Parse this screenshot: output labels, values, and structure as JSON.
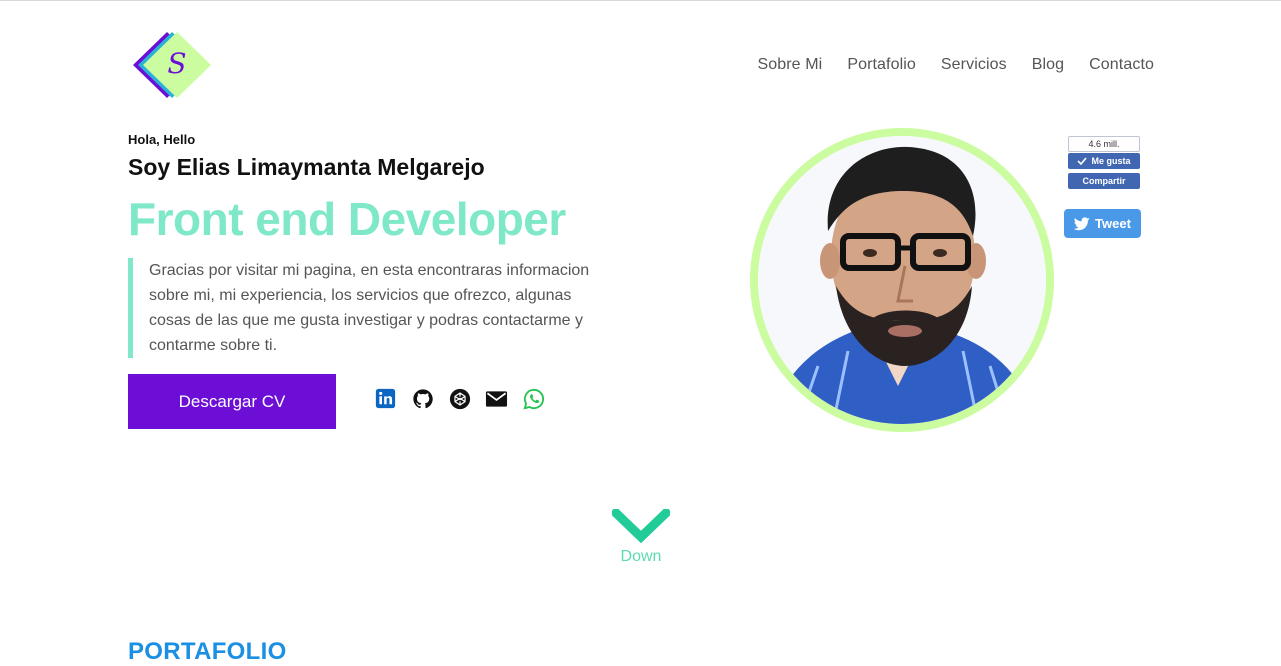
{
  "nav": {
    "items": [
      "Sobre Mi",
      "Portafolio",
      "Servicios",
      "Blog",
      "Contacto"
    ]
  },
  "logo": {
    "letter": "S"
  },
  "hero": {
    "greeting": "Hola, Hello",
    "name": "Soy Elias Limaymanta Melgarejo",
    "role": "Front end Developer",
    "intro": "Gracias por visitar mi pagina, en esta encontraras informacion sobre mi, mi experiencia, los servicios que ofrezco, algunas cosas de las que me gusta investigar y podras contactarme y contarme sobre ti.",
    "cv_button": "Descargar CV"
  },
  "socials": [
    "linkedin-icon",
    "github-icon",
    "codepen-icon",
    "mail-icon",
    "whatsapp-icon"
  ],
  "facebook": {
    "count": "4.6 mill.",
    "like_label": "Me gusta",
    "share_label": "Compartir"
  },
  "twitter": {
    "label": "Tweet"
  },
  "down": {
    "label": "Down"
  },
  "portfolio": {
    "title": "PORTAFOLIO"
  },
  "colors": {
    "accent": "#7ee8c9",
    "button": "#6c0ed6",
    "photo_ring": "#ccfca0",
    "section_title": "#1a8fe3",
    "down": "#21cc98"
  }
}
